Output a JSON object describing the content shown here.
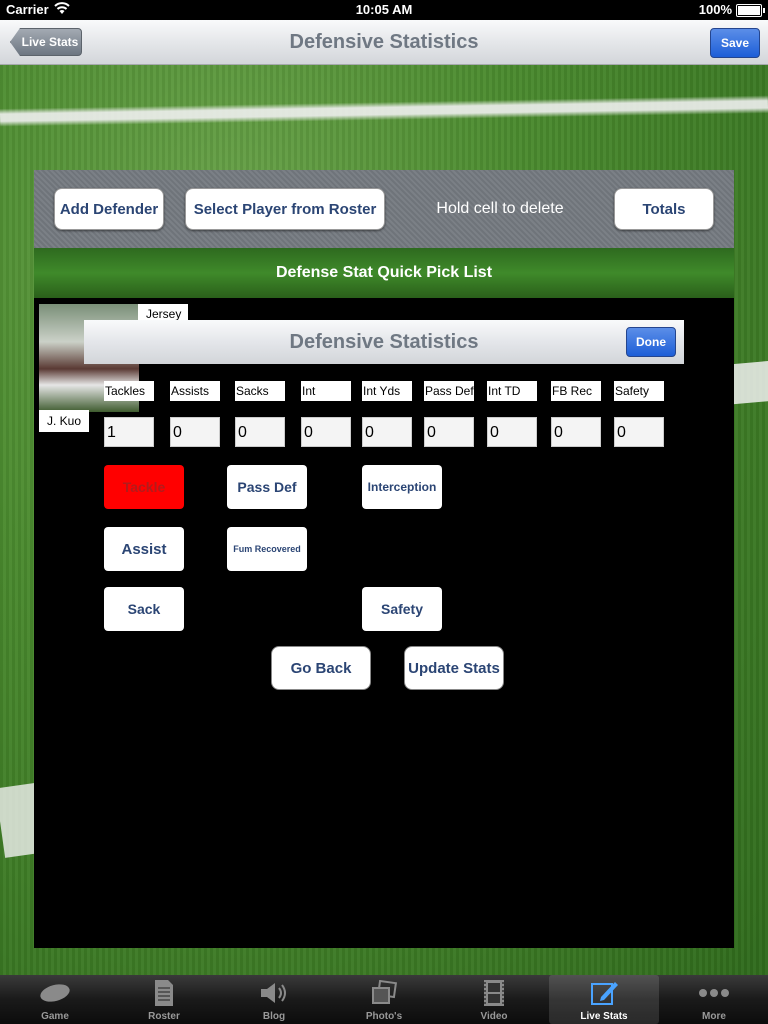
{
  "status_bar": {
    "carrier": "Carrier",
    "time": "10:05 AM",
    "battery": "100%"
  },
  "nav": {
    "title": "Defensive Statistics",
    "back_label": "Live Stats",
    "save_label": "Save"
  },
  "toolbar": {
    "add_defender": "Add Defender",
    "select_player": "Select Player from Roster",
    "hold_hint": "Hold cell to delete",
    "totals": "Totals"
  },
  "quick_pick_title": "Defense Stat Quick Pick List",
  "player": {
    "name": "J. Kuo",
    "jersey_label": "Jersey"
  },
  "modal": {
    "title": "Defensive Statistics",
    "done_label": "Done",
    "stats": [
      {
        "label": "Tackles",
        "value": "1"
      },
      {
        "label": "Assists",
        "value": "0"
      },
      {
        "label": "Sacks",
        "value": "0"
      },
      {
        "label": "Int",
        "value": "0"
      },
      {
        "label": "Int Yds",
        "value": "0"
      },
      {
        "label": "Pass Def",
        "value": "0"
      },
      {
        "label": "Int TD",
        "value": "0"
      },
      {
        "label": "FB Rec",
        "value": "0"
      },
      {
        "label": "Safety",
        "value": "0"
      }
    ],
    "actions": {
      "tackle": "Tackle",
      "pass_def": "Pass Def",
      "interception": "Interception",
      "assist": "Assist",
      "fum_recovered": "Fum Recovered",
      "sack": "Sack",
      "safety": "Safety"
    },
    "go_back": "Go Back",
    "update_stats": "Update Stats"
  },
  "tabs": [
    {
      "label": "Game",
      "icon": "football-icon"
    },
    {
      "label": "Roster",
      "icon": "document-icon"
    },
    {
      "label": "Blog",
      "icon": "megaphone-icon"
    },
    {
      "label": "Photo's",
      "icon": "photos-icon"
    },
    {
      "label": "Video",
      "icon": "film-icon"
    },
    {
      "label": "Live Stats",
      "icon": "edit-icon",
      "active": true
    },
    {
      "label": "More",
      "icon": "more-icon"
    }
  ],
  "colors": {
    "accent_blue": "#1d5ed7",
    "button_text": "#2b4574",
    "active_red": "#ff0000"
  }
}
